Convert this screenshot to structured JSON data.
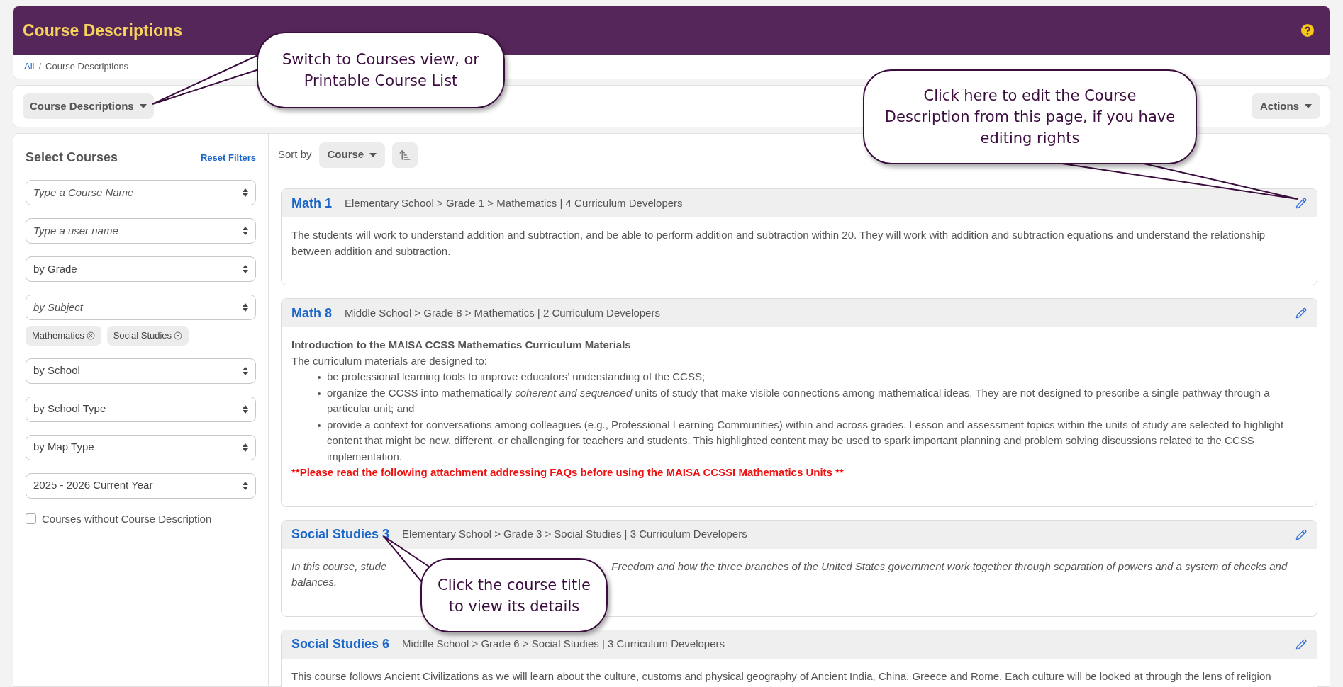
{
  "header": {
    "title": "Course Descriptions"
  },
  "breadcrumb": {
    "separator": "/",
    "items": [
      {
        "label": "All",
        "kind": "link"
      },
      {
        "label": "Course Descriptions",
        "kind": "current"
      }
    ]
  },
  "toolbar": {
    "view_menu": "Course Descriptions",
    "actions": "Actions"
  },
  "filters": {
    "title": "Select Courses",
    "reset": "Reset Filters",
    "fields": [
      {
        "placeholder": "Type a Course Name"
      },
      {
        "placeholder": "Type a user name"
      },
      {
        "value": "by Grade"
      },
      {
        "placeholder": "by Subject",
        "tags": [
          "Mathematics",
          "Social Studies"
        ]
      },
      {
        "value": "by School"
      },
      {
        "value": "by School Type"
      },
      {
        "value": "by Map Type"
      },
      {
        "value": "2025 - 2026 Current Year"
      }
    ],
    "checkbox": {
      "label": "Courses without Course Description",
      "checked": false
    }
  },
  "sort": {
    "label": "Sort by",
    "value": "Course"
  },
  "courses": [
    {
      "title": "Math 1",
      "path": "Elementary School > Grade 1 > Mathematics | 4 Curriculum Developers",
      "body": [
        {
          "kind": "paragraph",
          "text": "The students will work to understand addition and subtraction, and be able to perform addition and subtraction within 20. They will work with addition and subtraction equations and understand the relationship between addition and subtraction."
        }
      ]
    },
    {
      "title": "Math 8",
      "path": "Middle School > Grade 8 > Mathematics | 2 Curriculum Developers",
      "body": [
        {
          "kind": "heading",
          "text": "Introduction to the MAISA CCSS Mathematics Curriculum Materials"
        },
        {
          "kind": "paragraph",
          "text": "The curriculum materials are designed to:"
        },
        {
          "kind": "list",
          "items": [
            "be professional learning tools to improve educators’ understanding of the CCSS;",
            "organize the CCSS into mathematically *coherent and sequenced* units of study that make visible connections among mathematical ideas. They are not designed to prescribe a single pathway through a particular unit; and",
            "provide a context for conversations among colleagues (e.g., Professional Learning Communities) within and across grades. Lesson and assessment topics within the units of study are selected to highlight content that might be new, different, or challenging for teachers and students. This highlighted content may be used to spark important planning and problem solving discussions related to the CCSS implementation."
          ]
        },
        {
          "kind": "notice",
          "text": "**Please read the following attachment addressing FAQs before using the MAISA CCSSI Mathematics Units **"
        }
      ]
    },
    {
      "title": "Social Studies 3",
      "path": "Elementary School > Grade 3 > Social Studies | 3 Curriculum Developers",
      "body": [
        {
          "kind": "covered",
          "before": "In this course, stude",
          "after": [
            "Freedom and how the three branches of the United States government work together through separation of powers and a system of checks and",
            "balances."
          ]
        }
      ]
    },
    {
      "title": "Social Studies 6",
      "path": "Middle School > Grade 6 > Social Studies | 3 Curriculum Developers",
      "body": [
        {
          "kind": "cut",
          "text": "This course follows Ancient Civilizations as we will learn about the culture, customs and physical geography of Ancient India, China, Greece and Rome. Each culture will be looked at through the lens of religion"
        }
      ]
    }
  ],
  "callouts": [
    {
      "text": "Switch to Courses view, or Printable Course List"
    },
    {
      "text": "Click here to edit the Course Description from this page, if you have editing rights"
    },
    {
      "text": "Click the course title to view its details"
    }
  ]
}
